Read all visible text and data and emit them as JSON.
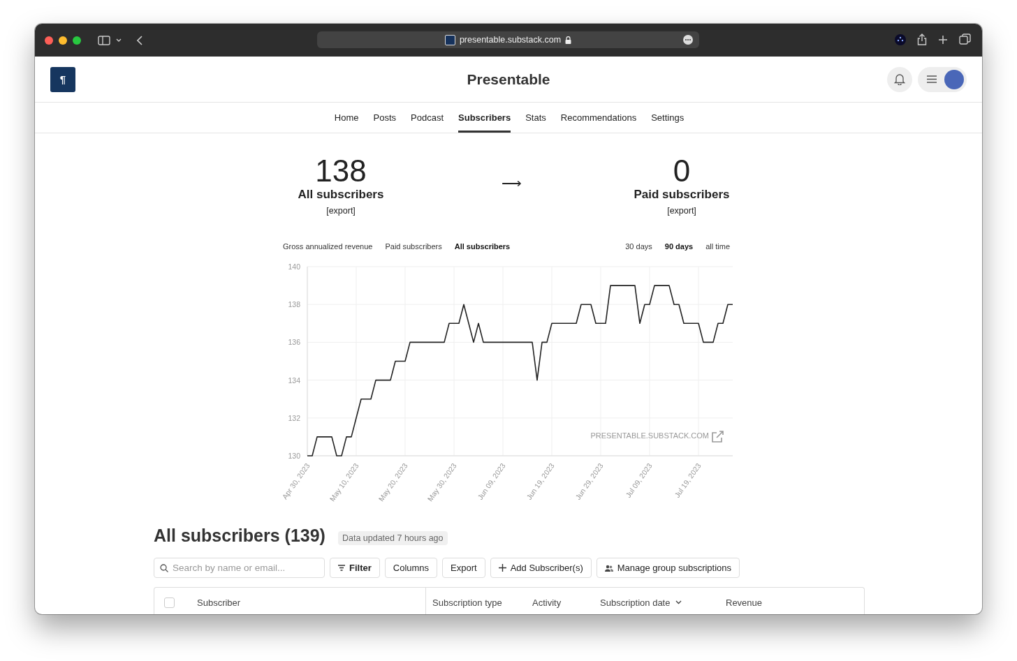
{
  "browser": {
    "url": "presentable.substack.com"
  },
  "header": {
    "logo": "¶",
    "title": "Presentable"
  },
  "nav": [
    {
      "label": "Home",
      "selected": false
    },
    {
      "label": "Posts",
      "selected": false
    },
    {
      "label": "Podcast",
      "selected": false
    },
    {
      "label": "Subscribers",
      "selected": true
    },
    {
      "label": "Stats",
      "selected": false
    },
    {
      "label": "Recommendations",
      "selected": false
    },
    {
      "label": "Settings",
      "selected": false
    }
  ],
  "stats": [
    {
      "value": "138",
      "label": "All subscribers",
      "export": "[export]"
    },
    {
      "value": "0",
      "label": "Paid subscribers",
      "export": "[export]"
    }
  ],
  "stats_arrow": "⟶",
  "chart": {
    "metrics": [
      {
        "label": "Gross annualized revenue",
        "selected": false
      },
      {
        "label": "Paid subscribers",
        "selected": false
      },
      {
        "label": "All subscribers",
        "selected": true
      }
    ],
    "ranges": [
      {
        "label": "30 days",
        "selected": false
      },
      {
        "label": "90 days",
        "selected": true
      },
      {
        "label": "all time",
        "selected": false
      }
    ],
    "watermark": "PRESENTABLE.SUBSTACK.COM",
    "chart_data": {
      "type": "line",
      "categories": [
        "Apr 30, 2023",
        null,
        null,
        null,
        null,
        null,
        null,
        null,
        null,
        null,
        "May 10, 2023",
        null,
        null,
        null,
        null,
        null,
        null,
        null,
        null,
        null,
        "May 20, 2023",
        null,
        null,
        null,
        null,
        null,
        null,
        null,
        null,
        null,
        "May 30, 2023",
        null,
        null,
        null,
        null,
        null,
        null,
        null,
        null,
        null,
        "Jun 09, 2023",
        null,
        null,
        null,
        null,
        null,
        null,
        null,
        null,
        null,
        "Jun 19, 2023",
        null,
        null,
        null,
        null,
        null,
        null,
        null,
        null,
        null,
        "Jun 29, 2023",
        null,
        null,
        null,
        null,
        null,
        null,
        null,
        null,
        null,
        "Jul 09, 2023",
        null,
        null,
        null,
        null,
        null,
        null,
        null,
        null,
        null,
        "Jul 19, 2023",
        null,
        null,
        null,
        null,
        null,
        null,
        null
      ],
      "series": [
        {
          "color": "#222222",
          "values": [
            130,
            130,
            131,
            131,
            131,
            131,
            130,
            130,
            131,
            131,
            132,
            133,
            133,
            133,
            134,
            134,
            134,
            134,
            135,
            135,
            135,
            136,
            136,
            136,
            136,
            136,
            136,
            136,
            136,
            137,
            137,
            137,
            138,
            137,
            136,
            137,
            136,
            136,
            136,
            136,
            136,
            136,
            136,
            136,
            136,
            136,
            136,
            134,
            136,
            136,
            137,
            137,
            137,
            137,
            137,
            137,
            138,
            138,
            138,
            137,
            137,
            137,
            139,
            139,
            139,
            139,
            139,
            139,
            137,
            138,
            138,
            139,
            139,
            139,
            139,
            138,
            138,
            137,
            137,
            137,
            137,
            136,
            136,
            136,
            137,
            137,
            138,
            138
          ]
        }
      ],
      "ylim": [
        130,
        140
      ],
      "grid": true,
      "yticks": [
        130,
        132,
        134,
        136,
        138,
        140
      ]
    }
  },
  "subscribers": {
    "title": "All subscribers (139)",
    "updated": "Data updated 7 hours ago",
    "search": {
      "placeholder": "Search by name or email..."
    },
    "buttons": [
      {
        "label": "Filter",
        "kind": "filter"
      },
      {
        "label": "Columns",
        "kind": "plain"
      },
      {
        "label": "Export",
        "kind": "plain"
      },
      {
        "label": "Add Subscriber(s)",
        "kind": "add"
      },
      {
        "label": "Manage group subscriptions",
        "kind": "group"
      }
    ],
    "table": {
      "select_all": {
        "checked": false
      },
      "columns": [
        {
          "label": "Subscriber",
          "sorted": false
        },
        {
          "label": "Subscription type",
          "sorted": false
        },
        {
          "label": "Activity",
          "sorted": false
        },
        {
          "label": "Subscription date",
          "sorted": true
        },
        {
          "label": "Revenue",
          "sorted": false
        }
      ]
    }
  }
}
